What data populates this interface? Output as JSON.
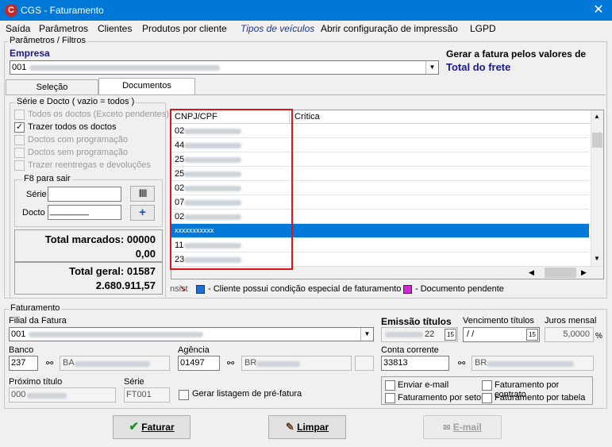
{
  "window": {
    "title": "CGS - Faturamento"
  },
  "menu": [
    "Saída",
    "Parâmetros",
    "Clientes",
    "Produtos por cliente",
    "Tipos de veículos",
    "Abrir configuração de impressão",
    "LGPD"
  ],
  "params": {
    "group_label": "Parâmetros / Filtros",
    "empresa_label": "Empresa",
    "empresa_value": "001",
    "gerar_label": "Gerar a fatura pelos valores de",
    "gerar_value": "Total do frete"
  },
  "tabs": [
    "Seleção",
    "Documentos"
  ],
  "serie_group": {
    "label": "Série e Docto  ( vazio = todos )",
    "options": [
      {
        "label": "Todos os doctos (Exceto pendentes)",
        "checked": false,
        "enabled": false
      },
      {
        "label": "Trazer todos os doctos",
        "checked": true,
        "enabled": true
      },
      {
        "label": "Doctos com programação",
        "checked": false,
        "enabled": false
      },
      {
        "label": "Doctos sem programação",
        "checked": false,
        "enabled": false
      },
      {
        "label": "Trazer reentregas e devoluções",
        "checked": false,
        "enabled": false
      }
    ]
  },
  "f8": {
    "label": "F8 para sair",
    "serie_label": "Série",
    "docto_label": "Docto",
    "docto_value": "________"
  },
  "totals": {
    "marcados_label": "Total marcados:",
    "marcados_count": "00000",
    "marcados_value": "0,00",
    "geral_label": "Total geral:",
    "geral_count": "01587",
    "geral_value": "2.680.911,57"
  },
  "grid": {
    "columns": [
      "CNPJ/CPF",
      "Crítica"
    ],
    "rows": [
      {
        "prefix": "02",
        "selected": false
      },
      {
        "prefix": "44",
        "selected": false
      },
      {
        "prefix": "25",
        "selected": false
      },
      {
        "prefix": "25",
        "selected": false
      },
      {
        "prefix": "02",
        "selected": false
      },
      {
        "prefix": "07",
        "selected": false
      },
      {
        "prefix": "02",
        "selected": false
      },
      {
        "prefix": "xxxxxxxxxxx",
        "selected": true
      },
      {
        "prefix": "11",
        "selected": false
      },
      {
        "prefix": "23",
        "selected": false
      }
    ]
  },
  "legend": {
    "prefix": "nsist",
    "items": [
      {
        "color": "#1e6fd9",
        "label": "- Cliente possui condição especial de faturamento"
      },
      {
        "color": "#e020e0",
        "label": "- Documento pendente"
      }
    ]
  },
  "faturamento": {
    "group_label": "Faturamento",
    "filial_label": "Filial da Fatura",
    "filial_value": "001",
    "emissao_label": "Emissão títulos",
    "emissao_value": "22",
    "venc_label": "Vencimento títulos",
    "venc_value": " / /",
    "juros_label": "Juros mensal",
    "juros_value": "5,0000",
    "juros_unit": "%",
    "banco_label": "Banco",
    "banco_value": "237",
    "banco_desc": "BA",
    "agencia_label": "Agência",
    "agencia_value": "01497",
    "agencia_desc": "BR",
    "conta_label": "Conta corrente",
    "conta_value": "33813",
    "conta_desc": "BR",
    "proximo_label": "Próximo título",
    "proximo_value": "000",
    "serie_label": "Série",
    "serie_value": "FT001",
    "gerar_listagem": "Gerar listagem de pré-fatura",
    "opts": [
      "Enviar e-mail",
      "Faturamento por contrato",
      "Faturamento por setor",
      "Faturamento por tabela"
    ]
  },
  "buttons": {
    "faturar": "Faturar",
    "limpar": "Limpar",
    "email": "E-mail"
  }
}
